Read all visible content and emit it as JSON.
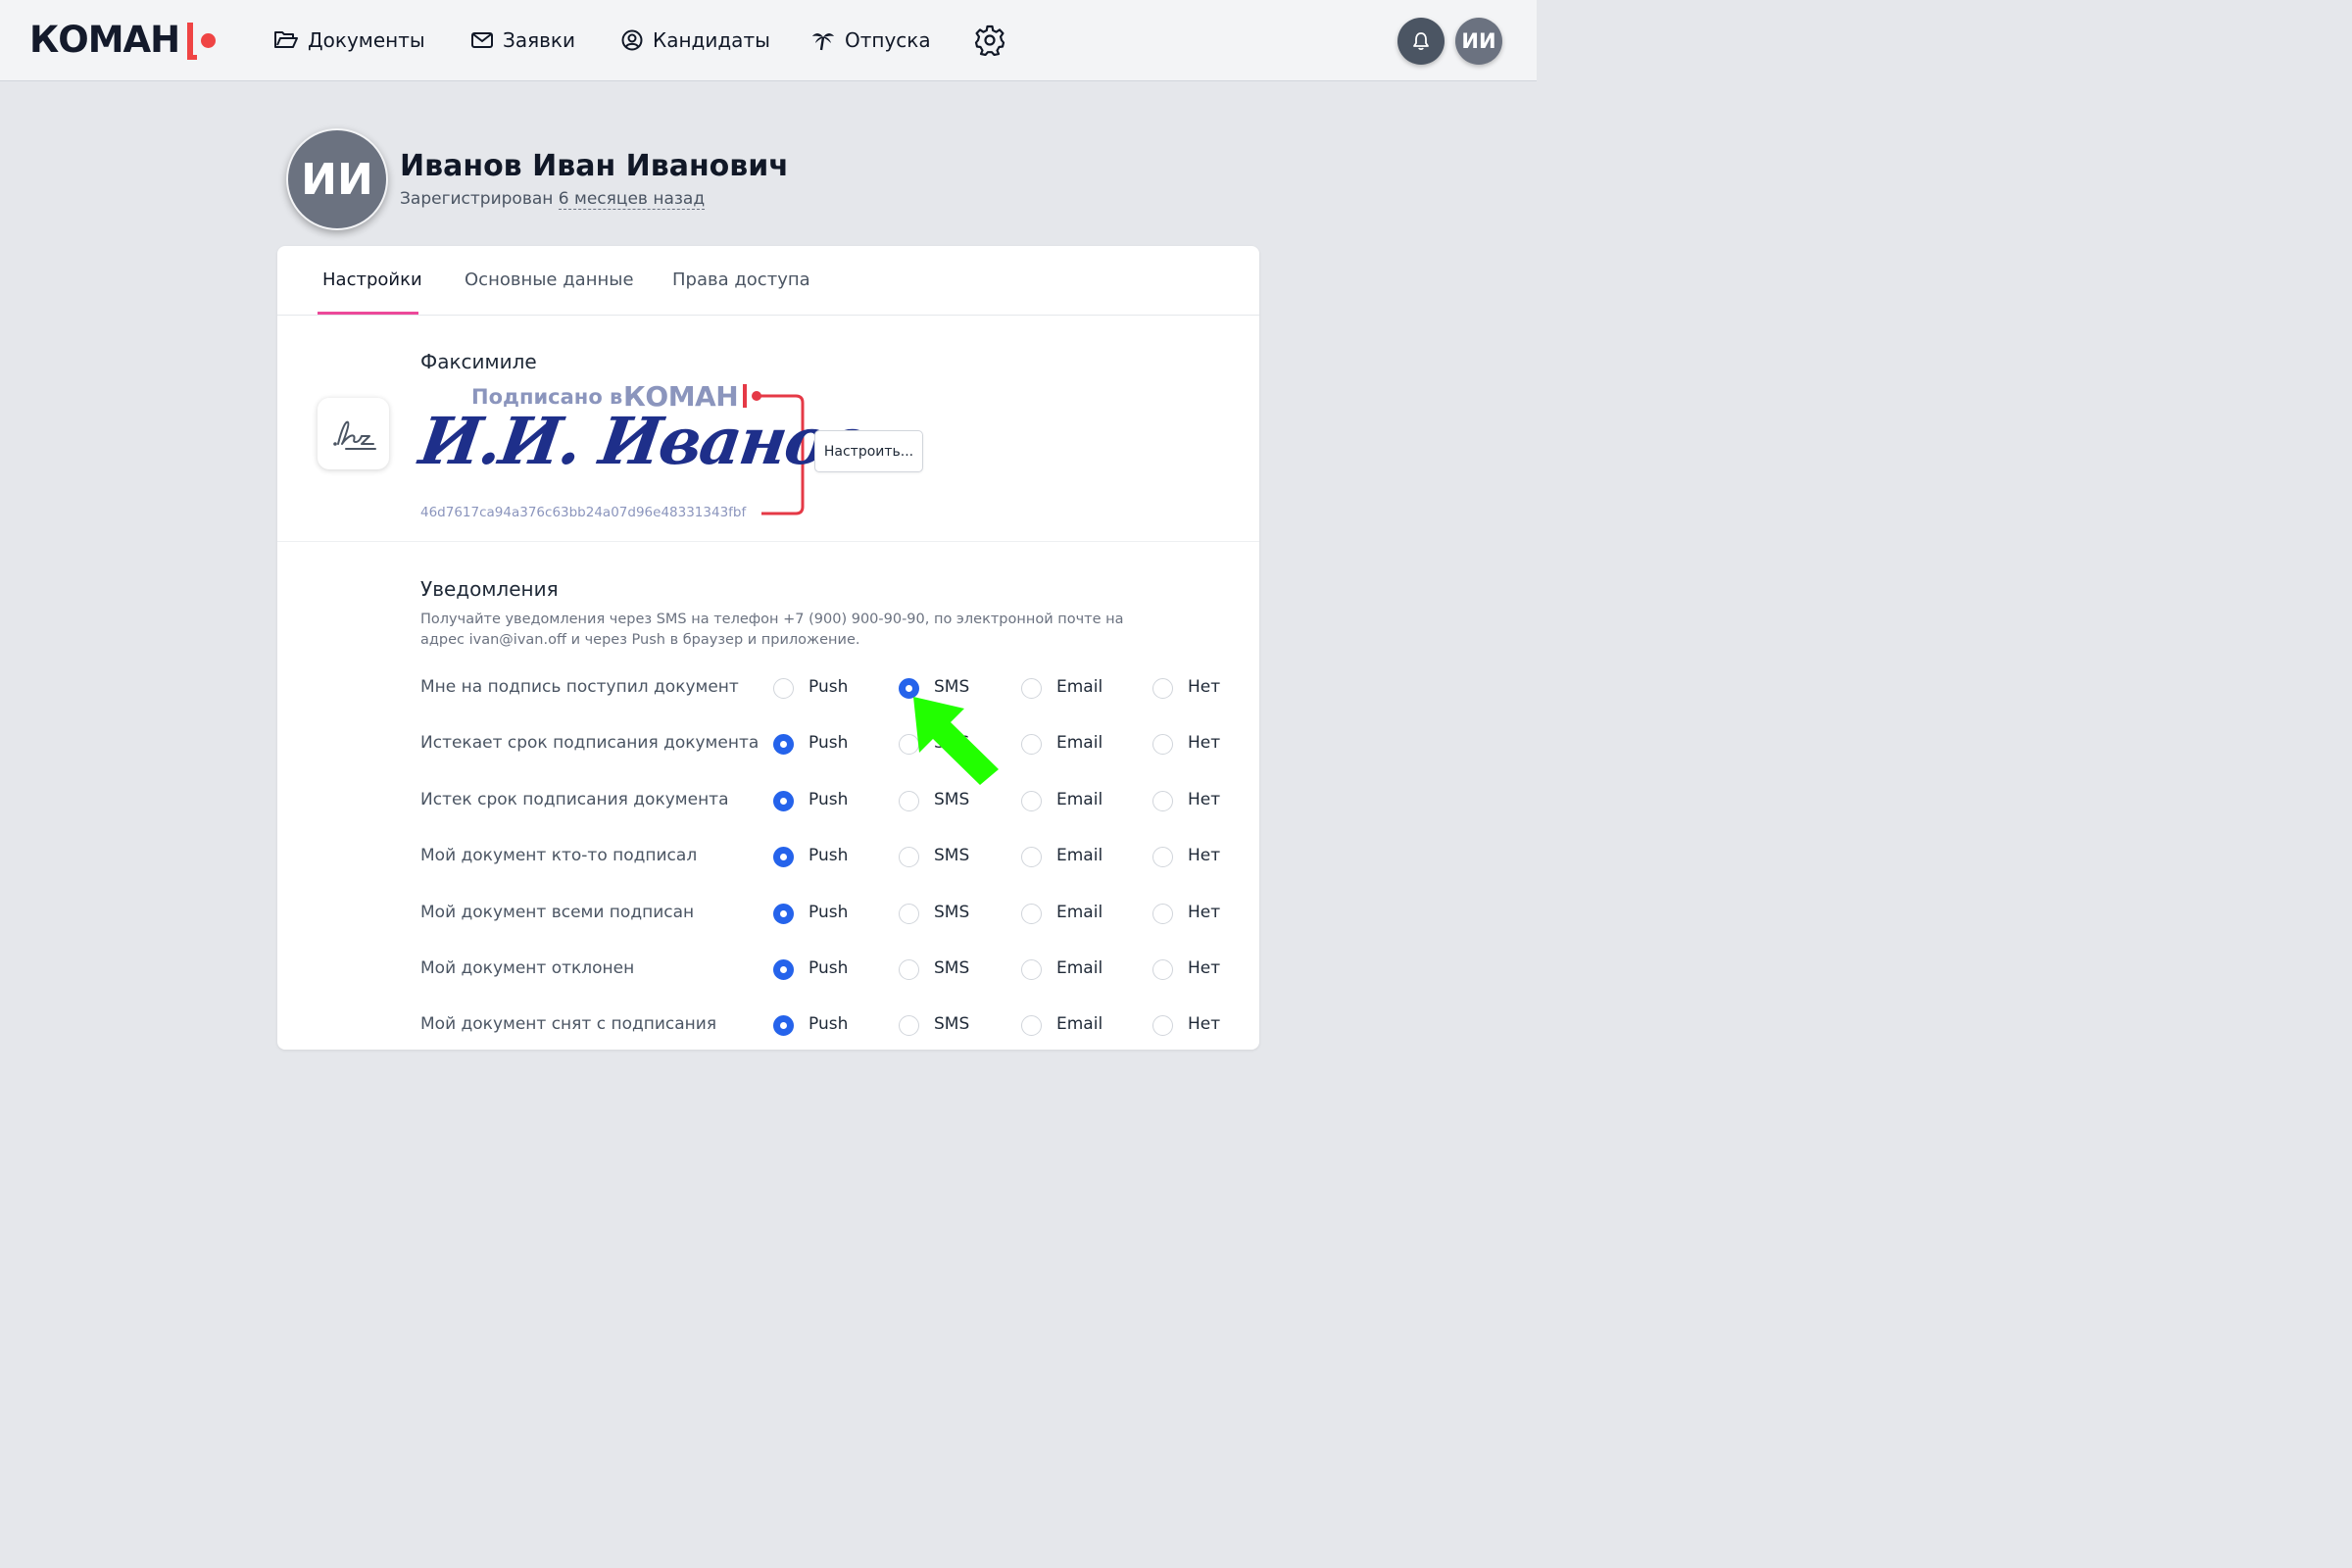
{
  "header": {
    "logo_text": "КОМАН",
    "nav": [
      {
        "label": "Документы",
        "icon": "folder-open-icon"
      },
      {
        "label": "Заявки",
        "icon": "envelope-icon"
      },
      {
        "label": "Кандидаты",
        "icon": "user-circle-icon"
      },
      {
        "label": "Отпуска",
        "icon": "palm-tree-icon"
      }
    ],
    "settings_icon": "gear-icon",
    "notifications_icon": "bell-icon",
    "user_initials": "ИИ"
  },
  "profile": {
    "initials": "ИИ",
    "name": "Иванов Иван Иванович",
    "registered_prefix": "Зарегистрирован",
    "registered_ago": "6 месяцев назад"
  },
  "tabs": [
    {
      "label": "Настройки",
      "active": true
    },
    {
      "label": "Основные данные",
      "active": false
    },
    {
      "label": "Права доступа",
      "active": false
    }
  ],
  "facsimile": {
    "title": "Факсимиле",
    "icon": "signature-icon",
    "stamp_label": "Подписано в",
    "stamp_logo": "КОМАН",
    "signature_text": "И.И. Иванов",
    "hash": "46d7617ca94a376c63bb24a07d96e48331343fbf",
    "configure_button": "Настроить..."
  },
  "notifications": {
    "title": "Уведомления",
    "description": "Получайте уведомления через SMS на телефон +7 (900) 900-90-90, по электронной почте на адрес ivan@ivan.off и через Push в браузер и приложение.",
    "options": [
      "Push",
      "SMS",
      "Email",
      "Нет"
    ],
    "rows": [
      {
        "label": "Мне на подпись поступил документ",
        "selected": "SMS"
      },
      {
        "label": "Истекает срок подписания документа",
        "selected": "Push"
      },
      {
        "label": "Истек срок подписания документа",
        "selected": "Push"
      },
      {
        "label": "Мой документ кто-то подписал",
        "selected": "Push"
      },
      {
        "label": "Мой документ всеми подписан",
        "selected": "Push"
      },
      {
        "label": "Мой документ отклонен",
        "selected": "Push"
      },
      {
        "label": "Мой документ снят с подписания",
        "selected": "Push"
      }
    ]
  },
  "colors": {
    "accent_pink": "#ec4899",
    "radio_blue": "#2563eb",
    "brand_red": "#ef4444",
    "pointer_green": "#22ff00"
  }
}
